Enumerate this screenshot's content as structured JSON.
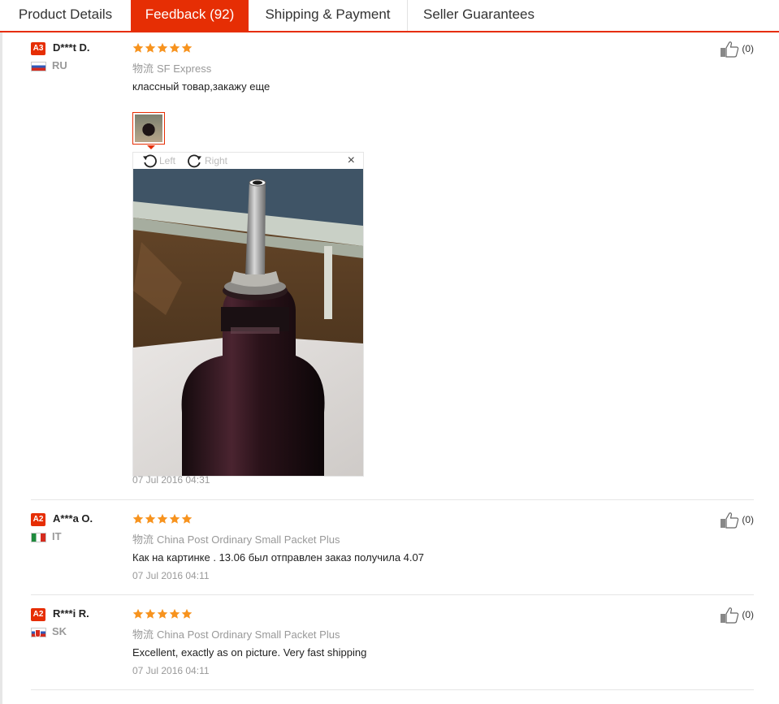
{
  "tabs": [
    {
      "label": "Product Details",
      "active": false
    },
    {
      "label": "Feedback (92)",
      "active": true
    },
    {
      "label": "Shipping & Payment",
      "active": false
    },
    {
      "label": "Seller Guarantees",
      "active": false
    }
  ],
  "colors": {
    "accent": "#e62e04",
    "star": "#f7931e",
    "muted": "#999999"
  },
  "photo_viewer": {
    "rotate_left_label": "Left",
    "rotate_right_label": "Right",
    "close_label": "×"
  },
  "reviews": [
    {
      "level": "A3",
      "buyer": "D***t D.",
      "country": "RU",
      "rating": 5,
      "logistics_label": "物流",
      "logistics": "SF Express",
      "text": "классный товар,закажу еще",
      "date": "07 Jul 2016 04:31",
      "helpful": "(0)"
    },
    {
      "level": "A2",
      "buyer": "A***a O.",
      "country": "IT",
      "rating": 5,
      "logistics_label": "物流",
      "logistics": "China Post Ordinary Small Packet Plus",
      "text": "Как на картинке . 13.06 был отправлен заказ получила 4.07",
      "date": "07 Jul 2016 04:11",
      "helpful": "(0)"
    },
    {
      "level": "A2",
      "buyer": "R***i R.",
      "country": "SK",
      "rating": 5,
      "logistics_label": "物流",
      "logistics": "China Post Ordinary Small Packet Plus",
      "text": "Excellent, exactly as on picture. Very fast shipping",
      "date": "07 Jul 2016 04:11",
      "helpful": "(0)"
    }
  ]
}
